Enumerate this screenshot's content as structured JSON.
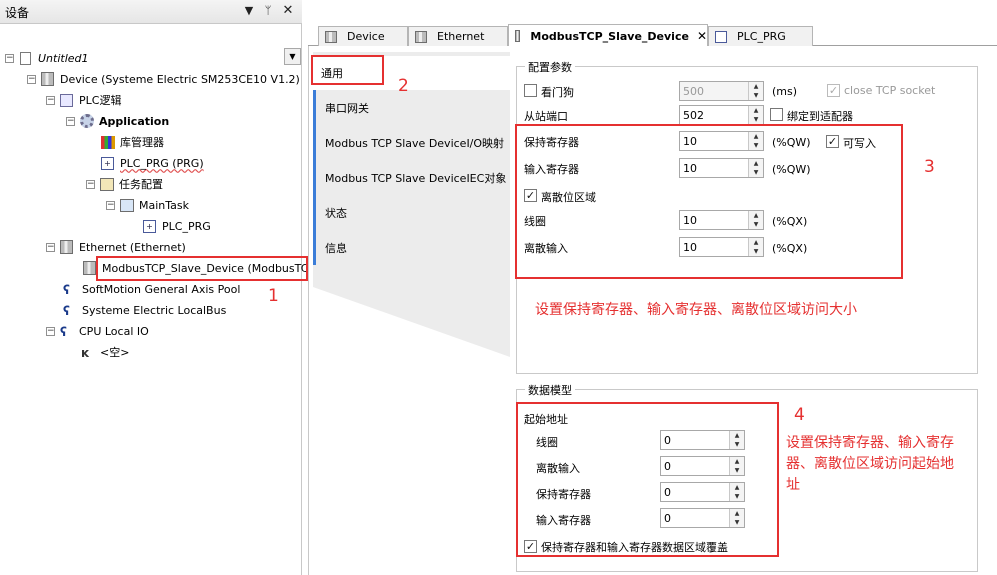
{
  "left_panel": {
    "title": "设备",
    "pin_icon": "pin-icon",
    "combo_value": "Untitled1",
    "tree": [
      {
        "label": "Untitled1",
        "icon": "project-icon"
      },
      {
        "label": "Device (Systeme Electric SM253CE10 V1.2)",
        "icon": "device-icon"
      },
      {
        "label": "PLC逻辑",
        "icon": "plc-logic-icon"
      },
      {
        "label": "Application",
        "icon": "application-gear-icon"
      },
      {
        "label": "库管理器",
        "icon": "library-icon"
      },
      {
        "label": "PLC_PRG (PRG)",
        "icon": "program-icon"
      },
      {
        "label": "任务配置",
        "icon": "task-config-icon"
      },
      {
        "label": "MainTask",
        "icon": "task-icon"
      },
      {
        "label": "PLC_PRG",
        "icon": "program-icon"
      },
      {
        "label": "Ethernet (Ethernet)",
        "icon": "device-icon"
      },
      {
        "label": "ModbusTCP_Slave_Device (ModbusTCP S",
        "icon": "device-icon"
      },
      {
        "label": "SoftMotion General Axis Pool",
        "icon": "axis-icon"
      },
      {
        "label": "Systeme Electric LocalBus",
        "icon": "axis-icon"
      },
      {
        "label": "CPU Local IO",
        "icon": "axis-icon"
      },
      {
        "label": "<空>",
        "icon": "empty-slot-icon"
      }
    ]
  },
  "tabs": [
    {
      "label": "Device"
    },
    {
      "label": "Ethernet"
    },
    {
      "label": "ModbusTCP_Slave_Device"
    },
    {
      "label": "PLC_PRG"
    }
  ],
  "side_nav": [
    {
      "label": "通用"
    },
    {
      "label": "串口网关"
    },
    {
      "label": "Modbus TCP Slave DeviceI/O映射"
    },
    {
      "label": "Modbus TCP Slave DeviceIEC对象"
    },
    {
      "label": "状态"
    },
    {
      "label": "信息"
    }
  ],
  "config": {
    "title": "配置参数",
    "watchdog_label": "看门狗",
    "watchdog_value": "500",
    "watchdog_unit": "(ms)",
    "close_socket_label": "close TCP socket",
    "slave_port_label": "从站端口",
    "slave_port_value": "502",
    "bind_adapter_label": "绑定到适配器",
    "holding_label": "保持寄存器",
    "holding_value": "10",
    "holding_unit": "(%QW)",
    "writable_label": "可写入",
    "input_label": "输入寄存器",
    "input_value": "10",
    "input_unit": "(%QW)",
    "discrete_area_label": "离散位区域",
    "coils_label": "线圈",
    "coils_value": "10",
    "coils_unit": "(%QX)",
    "discrete_input_label": "离散输入",
    "discrete_input_value": "10",
    "discrete_input_unit": "(%QX)"
  },
  "data_model": {
    "title": "数据模型",
    "start_address_label": "起始地址",
    "coils_label": "线圈",
    "coils_value": "0",
    "discrete_input_label": "离散输入",
    "discrete_input_value": "0",
    "holding_label": "保持寄存器",
    "holding_value": "0",
    "input_label": "输入寄存器",
    "input_value": "0",
    "overlap_label": "保持寄存器和输入寄存器数据区域覆盖"
  },
  "annotations": {
    "n1": "1",
    "n2": "2",
    "n3": "3",
    "n4": "4",
    "note3": "设置保持寄存器、输入寄存器、离散位区域访问大小",
    "note4_line1": "设置保持寄存器、输入寄存",
    "note4_line2": "器、离散位区域访问起始地",
    "note4_line3": "址"
  },
  "colors": {
    "annotation_red": "#e53030",
    "nav_accent": "#3b7dd8"
  }
}
